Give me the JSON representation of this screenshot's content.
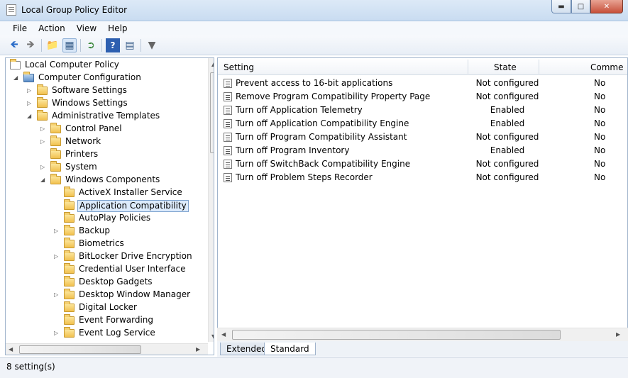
{
  "window": {
    "title": "Local Group Policy Editor"
  },
  "menu": [
    "File",
    "Action",
    "View",
    "Help"
  ],
  "tree": {
    "items": [
      {
        "label": "Local Computer Policy",
        "level": 0,
        "twisty": "",
        "icon": "policy"
      },
      {
        "label": "Computer Configuration",
        "level": 1,
        "twisty": "open",
        "icon": "computer"
      },
      {
        "label": "Software Settings",
        "level": 2,
        "twisty": "closed",
        "icon": "folder"
      },
      {
        "label": "Windows Settings",
        "level": 2,
        "twisty": "closed",
        "icon": "folder"
      },
      {
        "label": "Administrative Templates",
        "level": 2,
        "twisty": "open",
        "icon": "folder"
      },
      {
        "label": "Control Panel",
        "level": 3,
        "twisty": "closed",
        "icon": "folder"
      },
      {
        "label": "Network",
        "level": 3,
        "twisty": "closed",
        "icon": "folder"
      },
      {
        "label": "Printers",
        "level": 3,
        "twisty": "",
        "icon": "folder"
      },
      {
        "label": "System",
        "level": 3,
        "twisty": "closed",
        "icon": "folder"
      },
      {
        "label": "Windows Components",
        "level": 3,
        "twisty": "open",
        "icon": "folder"
      },
      {
        "label": "ActiveX Installer Service",
        "level": 4,
        "twisty": "",
        "icon": "folder"
      },
      {
        "label": "Application Compatibility",
        "level": 4,
        "twisty": "",
        "icon": "folder",
        "selected": true
      },
      {
        "label": "AutoPlay Policies",
        "level": 4,
        "twisty": "",
        "icon": "folder"
      },
      {
        "label": "Backup",
        "level": 4,
        "twisty": "closed",
        "icon": "folder"
      },
      {
        "label": "Biometrics",
        "level": 4,
        "twisty": "",
        "icon": "folder"
      },
      {
        "label": "BitLocker Drive Encryption",
        "level": 4,
        "twisty": "closed",
        "icon": "folder"
      },
      {
        "label": "Credential User Interface",
        "level": 4,
        "twisty": "",
        "icon": "folder"
      },
      {
        "label": "Desktop Gadgets",
        "level": 4,
        "twisty": "",
        "icon": "folder"
      },
      {
        "label": "Desktop Window Manager",
        "level": 4,
        "twisty": "closed",
        "icon": "folder"
      },
      {
        "label": "Digital Locker",
        "level": 4,
        "twisty": "",
        "icon": "folder"
      },
      {
        "label": "Event Forwarding",
        "level": 4,
        "twisty": "",
        "icon": "folder"
      },
      {
        "label": "Event Log Service",
        "level": 4,
        "twisty": "closed",
        "icon": "folder"
      }
    ]
  },
  "list": {
    "columns": {
      "setting": "Setting",
      "state": "State",
      "comment": "Comme"
    },
    "rows": [
      {
        "setting": "Prevent access to 16-bit applications",
        "state": "Not configured",
        "comment": "No"
      },
      {
        "setting": "Remove Program Compatibility Property Page",
        "state": "Not configured",
        "comment": "No"
      },
      {
        "setting": "Turn off Application Telemetry",
        "state": "Enabled",
        "comment": "No"
      },
      {
        "setting": "Turn off Application Compatibility Engine",
        "state": "Enabled",
        "comment": "No"
      },
      {
        "setting": "Turn off Program Compatibility Assistant",
        "state": "Not configured",
        "comment": "No"
      },
      {
        "setting": "Turn off Program Inventory",
        "state": "Enabled",
        "comment": "No"
      },
      {
        "setting": "Turn off SwitchBack Compatibility Engine",
        "state": "Not configured",
        "comment": "No"
      },
      {
        "setting": "Turn off Problem Steps Recorder",
        "state": "Not configured",
        "comment": "No"
      }
    ]
  },
  "tabs": [
    "Extended",
    "Standard"
  ],
  "active_tab": "Standard",
  "status": {
    "text": "8 setting(s)"
  }
}
